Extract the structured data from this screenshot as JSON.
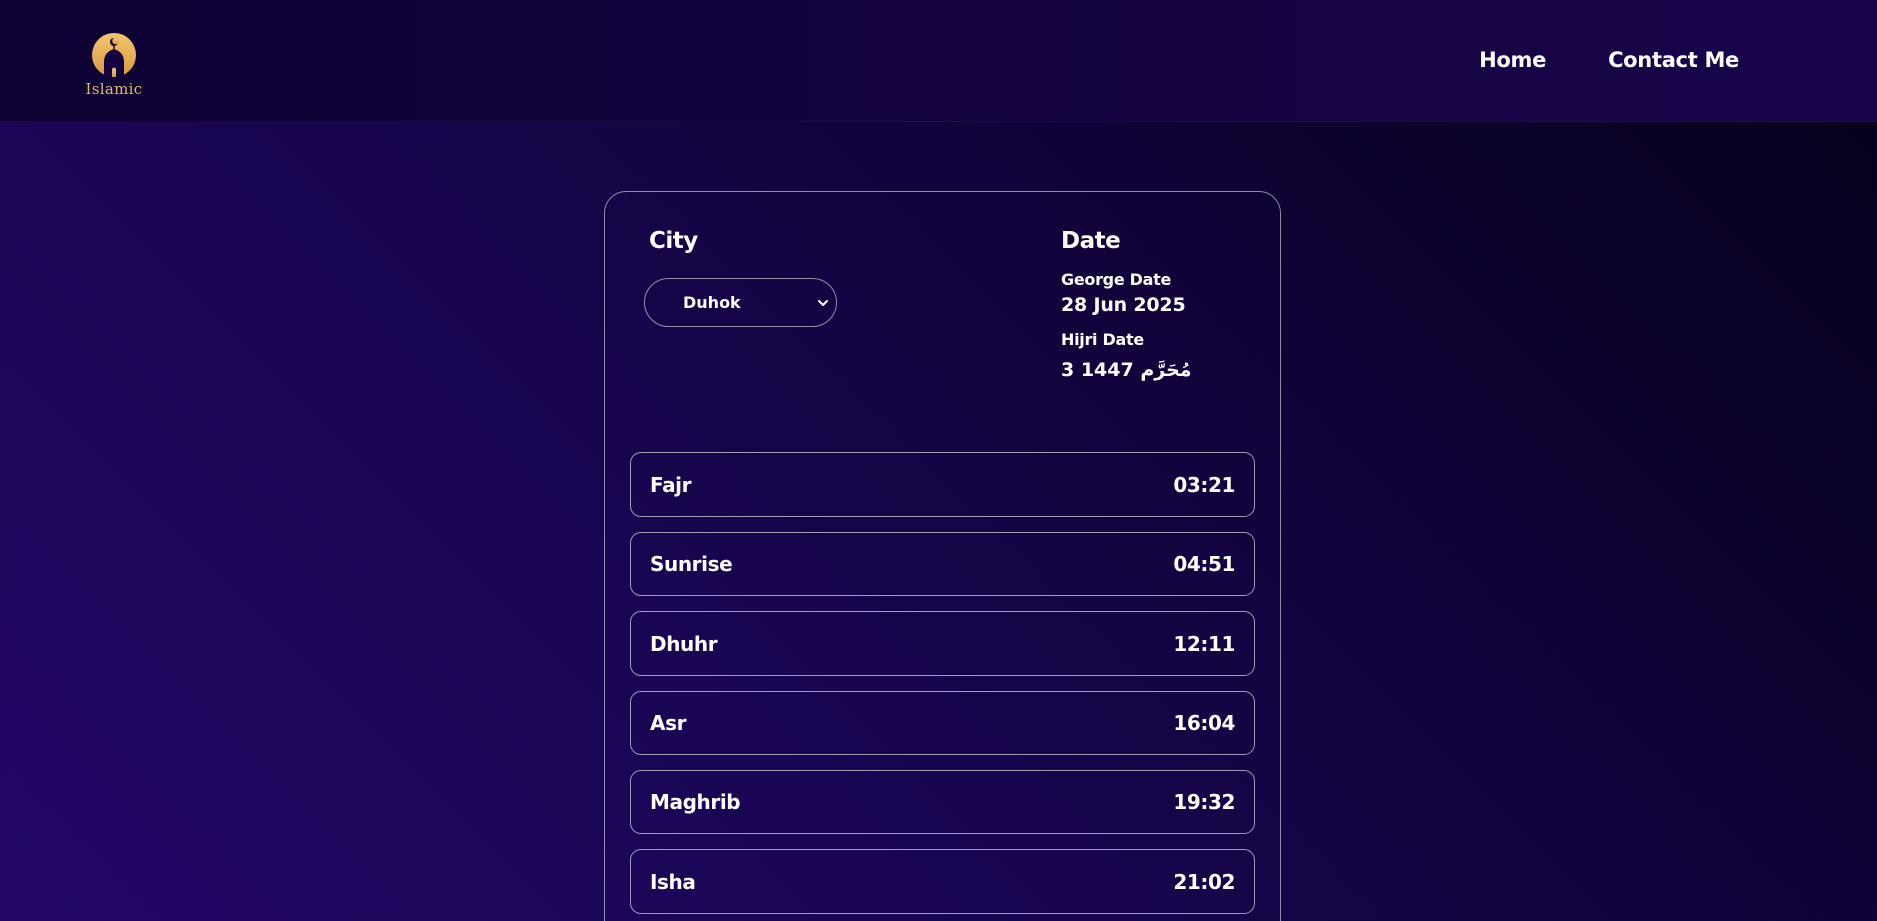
{
  "colors": {
    "background_dark": "#050018",
    "background_purple": "#220766",
    "navbar": "#14033f",
    "logo_gold": "#e7b866",
    "text": "#ffffff"
  },
  "nav": {
    "logo_text": "Islamic",
    "logo_icon": "mosque-icon",
    "links": [
      "Home",
      "Contact Me"
    ]
  },
  "city": {
    "heading": "City",
    "selected": "Duhok"
  },
  "date": {
    "heading": "Date",
    "gregorian_label": "George Date",
    "gregorian_value": "28 Jun 2025",
    "hijri_label": "Hijri Date",
    "hijri_value": "3 1447 مُحَرَّم"
  },
  "prayers": [
    {
      "name": "Fajr",
      "time": "03:21"
    },
    {
      "name": "Sunrise",
      "time": "04:51"
    },
    {
      "name": "Dhuhr",
      "time": "12:11"
    },
    {
      "name": "Asr",
      "time": "16:04"
    },
    {
      "name": "Maghrib",
      "time": "19:32"
    },
    {
      "name": "Isha",
      "time": "21:02"
    }
  ]
}
